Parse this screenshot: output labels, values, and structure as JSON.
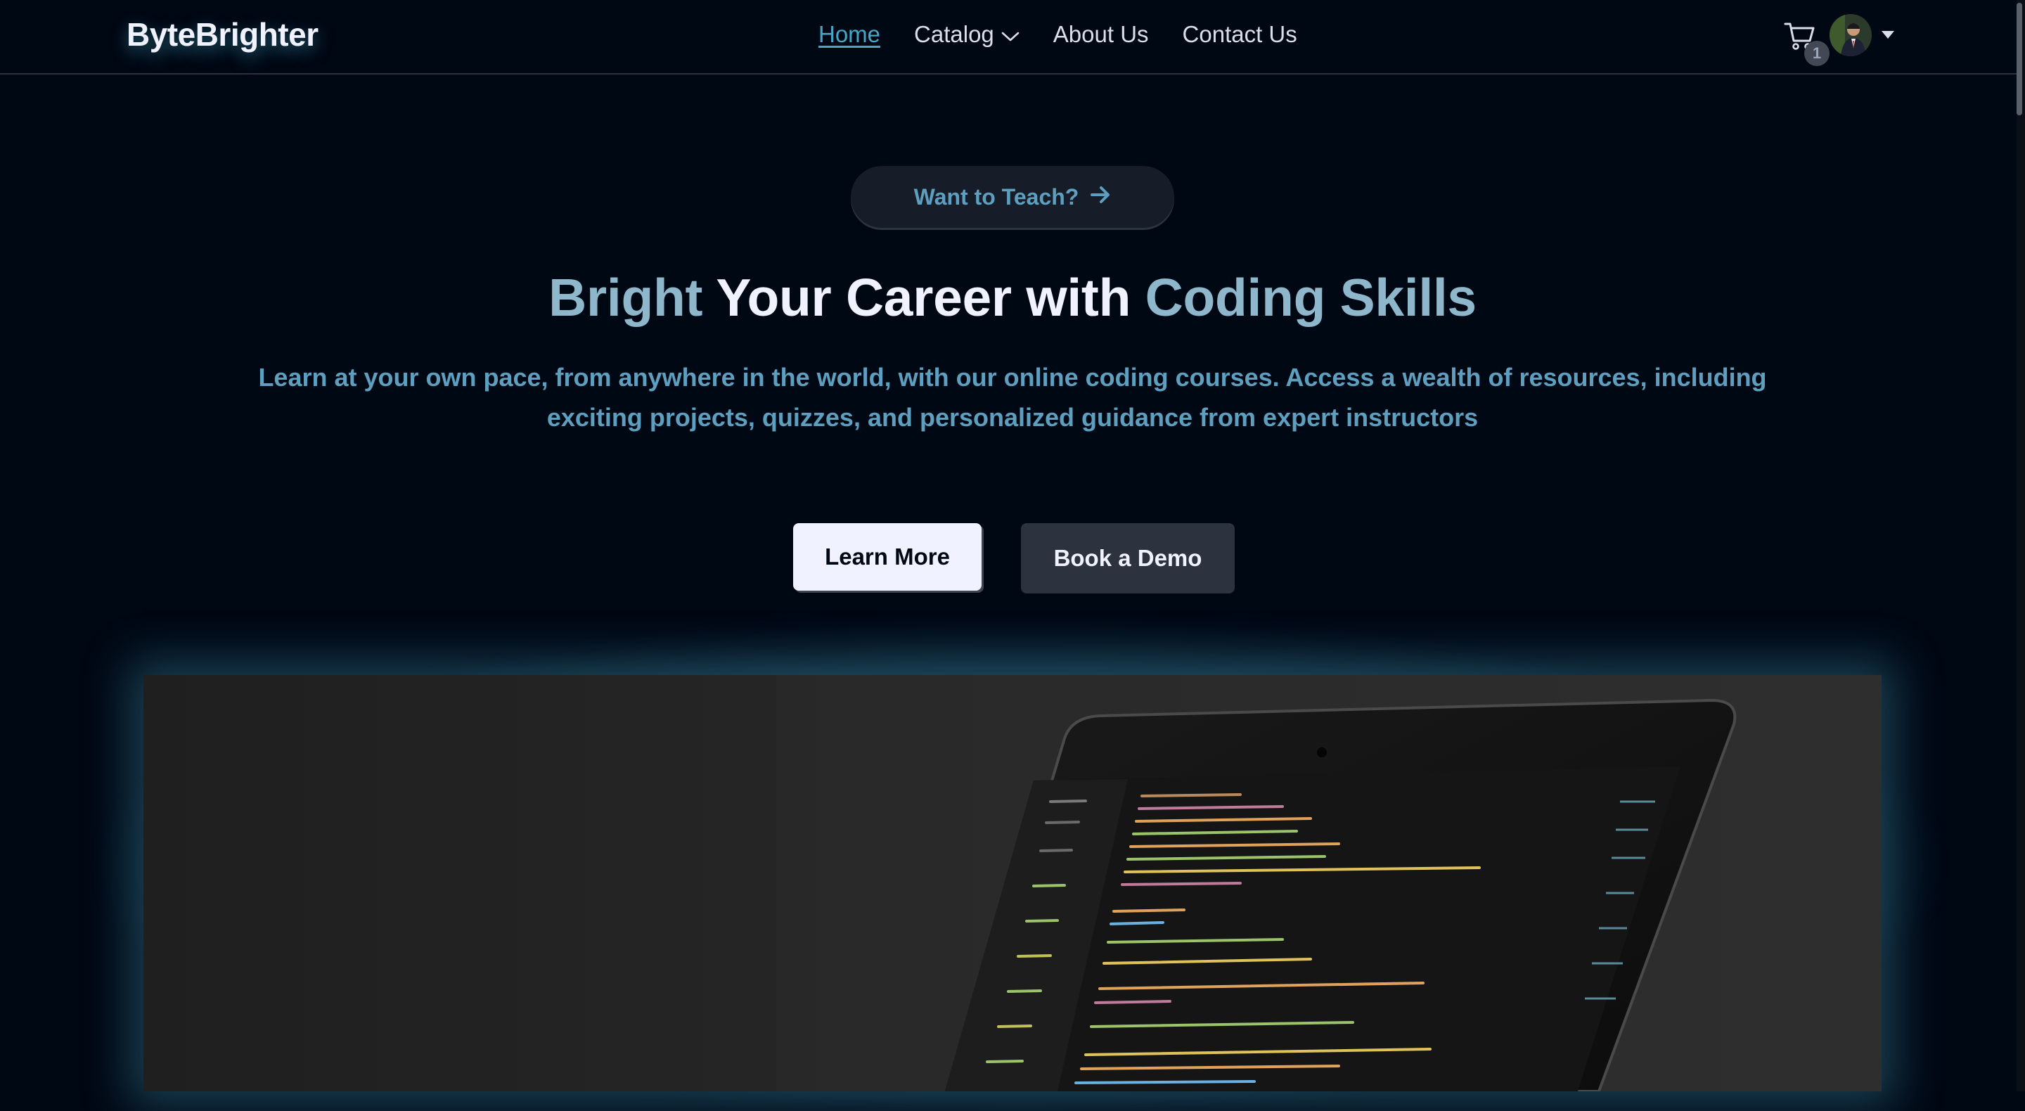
{
  "brand": {
    "logo_text": "ByteBrighter"
  },
  "nav": {
    "items": [
      {
        "label": "Home",
        "active": true
      },
      {
        "label": "Catalog",
        "has_dropdown": true
      },
      {
        "label": "About Us"
      },
      {
        "label": "Contact Us"
      }
    ],
    "cart_count": "1"
  },
  "hero": {
    "teach_label": "Want to Teach?",
    "headline": {
      "part1": "Bright",
      "part2": " Your Career with ",
      "part3": "Coding Skills"
    },
    "subtitle": "Learn at your own pace, from anywhere in the world, with our online coding courses. Access a wealth of resources, including exciting projects, quizzes, and personalized guidance from expert instructors",
    "learn_more_label": "Learn More",
    "book_demo_label": "Book a Demo"
  },
  "colors": {
    "background": "#000814",
    "accent_blue": "#47A5C5",
    "headline_accent": "#8EB7CB",
    "button_light": "#F1F2FF",
    "button_dark": "#2C333F"
  },
  "icons": {
    "cart": "cart-icon",
    "teach_arrow": "arrow-right-icon",
    "catalog_chevron": "chevron-down-icon",
    "profile_caret": "caret-down-icon"
  }
}
